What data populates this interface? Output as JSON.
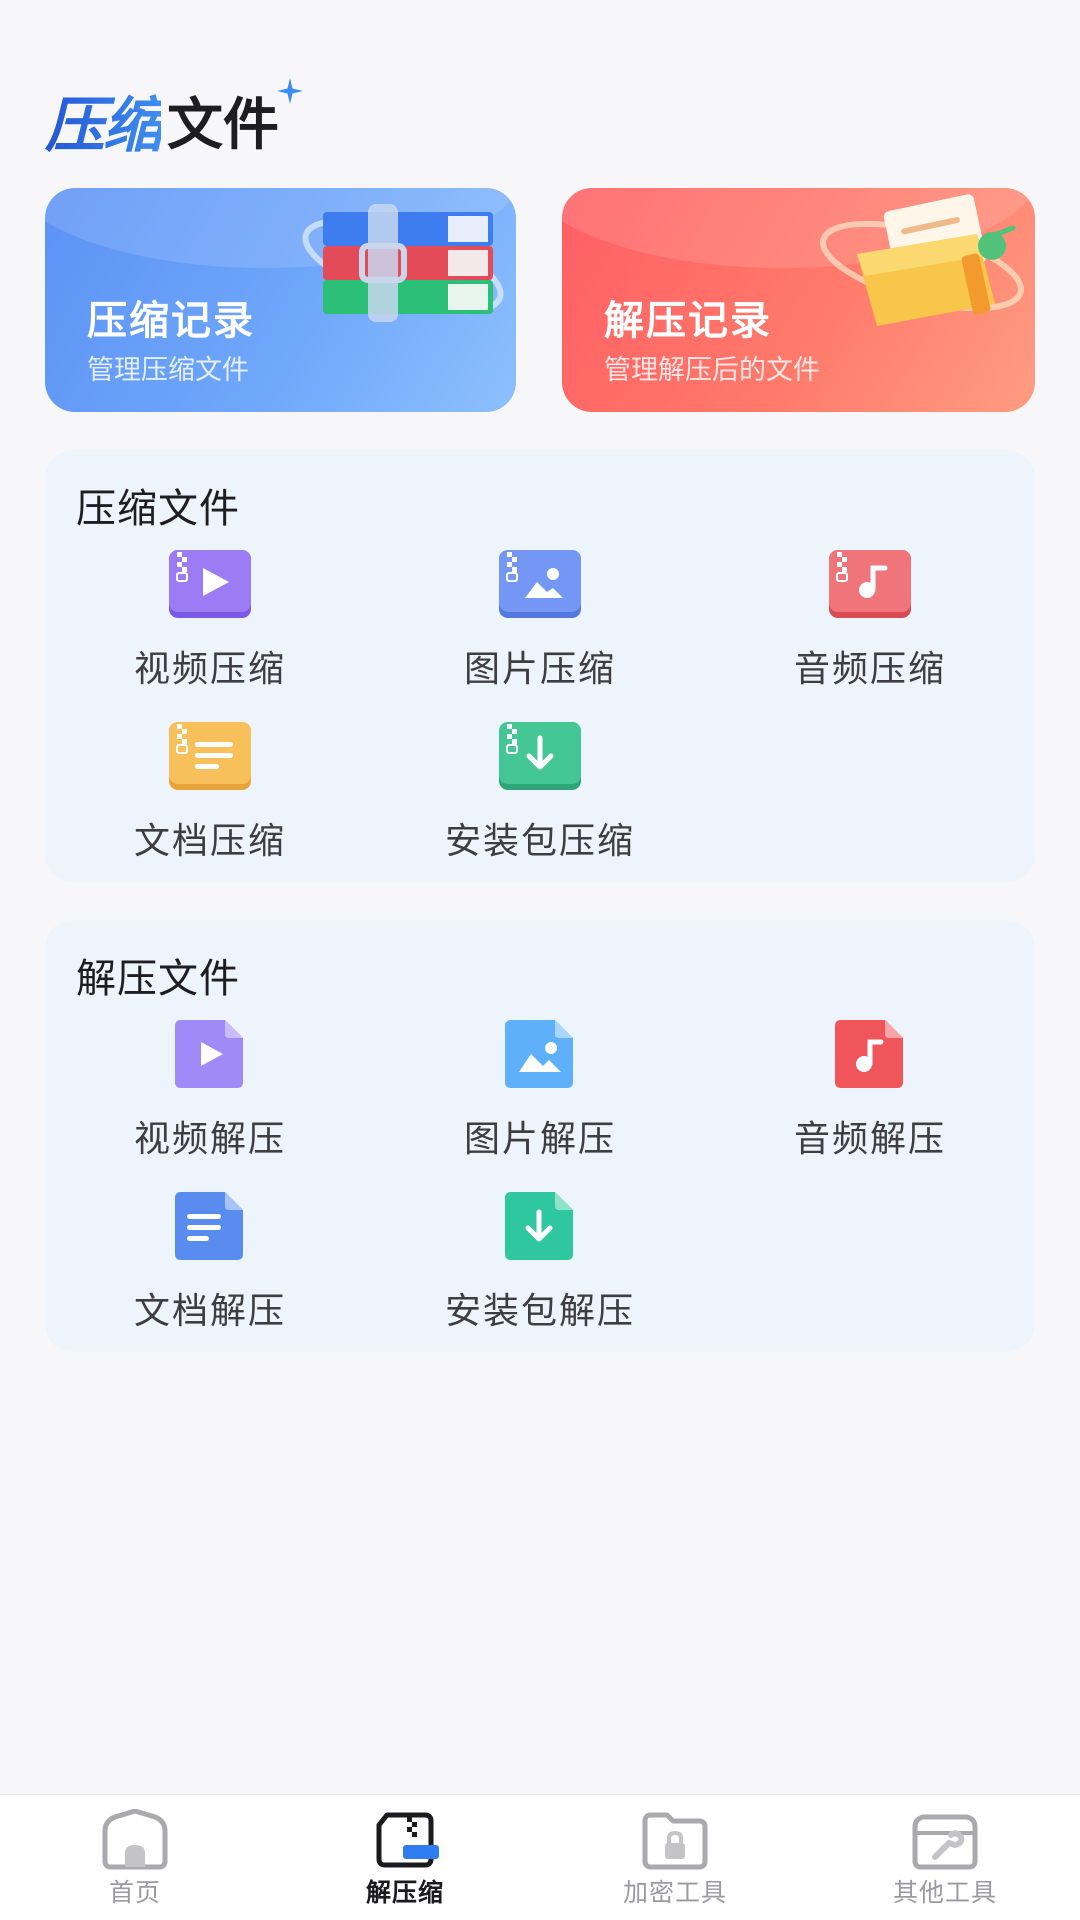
{
  "header": {
    "title_accent": "压缩",
    "title_rest": "文件"
  },
  "cards": {
    "compress_record": {
      "title": "压缩记录",
      "subtitle": "管理压缩文件"
    },
    "extract_record": {
      "title": "解压记录",
      "subtitle": "管理解压后的文件"
    }
  },
  "compress_panel": {
    "title": "压缩文件",
    "items": [
      {
        "label": "视频压缩",
        "icon": "video-zip-icon",
        "color": "#8c6ff0"
      },
      {
        "label": "图片压缩",
        "icon": "image-zip-icon",
        "color": "#6a8ff5"
      },
      {
        "label": "音频压缩",
        "icon": "audio-zip-icon",
        "color": "#ee6a6f"
      },
      {
        "label": "文档压缩",
        "icon": "document-zip-icon",
        "color": "#f5b850"
      },
      {
        "label": "安装包压缩",
        "icon": "package-zip-icon",
        "color": "#3fbf90"
      }
    ]
  },
  "extract_panel": {
    "title": "解压文件",
    "items": [
      {
        "label": "视频解压",
        "icon": "video-file-icon",
        "color": "#9a85f6"
      },
      {
        "label": "图片解压",
        "icon": "image-file-icon",
        "color": "#5fb2fa"
      },
      {
        "label": "音频解压",
        "icon": "audio-file-icon",
        "color": "#f06267"
      },
      {
        "label": "文档解压",
        "icon": "document-file-icon",
        "color": "#6190f0"
      },
      {
        "label": "安装包解压",
        "icon": "package-file-icon",
        "color": "#34c9a2"
      }
    ]
  },
  "nav": {
    "items": [
      {
        "label": "首页",
        "icon": "home-icon",
        "active": false
      },
      {
        "label": "解压缩",
        "icon": "archive-icon",
        "active": true
      },
      {
        "label": "加密工具",
        "icon": "lock-folder-icon",
        "active": false
      },
      {
        "label": "其他工具",
        "icon": "toolbox-icon",
        "active": false
      }
    ]
  },
  "colors": {
    "accent_blue": "#2f6fe0",
    "card_blue": "#6fa7fa",
    "card_red": "#ff6d66",
    "panel_bg": "#eef4fb",
    "nav_active_blue": "#2f7cf0"
  }
}
